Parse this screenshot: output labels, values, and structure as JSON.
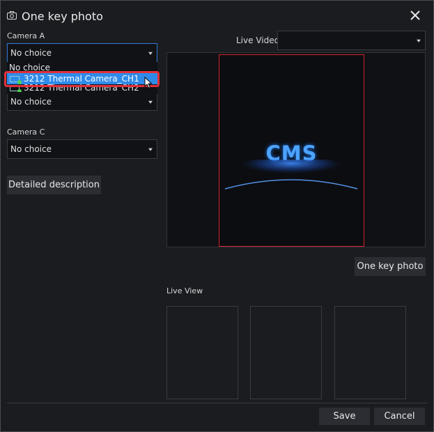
{
  "dialog": {
    "title": "One key photo",
    "icon": "camera-icon",
    "close_icon": "close-icon"
  },
  "left_panel": {
    "camera_a": {
      "label": "Camera A",
      "value": "No choice"
    },
    "dropdown_items": [
      {
        "label": "No choice"
      },
      {
        "label": "3212 Thermal Camera_CH1",
        "icon": "camera-icon",
        "selected": true
      },
      {
        "label": "3212 Thermal Camera_CH2",
        "icon": "camera-icon"
      }
    ],
    "camera_b": {
      "value": "No choice"
    },
    "camera_c": {
      "label": "Camera C",
      "value": "No choice"
    },
    "detailed_button": "Detailed description"
  },
  "right_panel": {
    "live_video_label": "Live Video",
    "live_video_value": "",
    "preview_logo": "CMS",
    "one_key_button": "One key photo",
    "live_view_label": "Live View"
  },
  "footer": {
    "save": "Save",
    "cancel": "Cancel"
  },
  "colors": {
    "background": "#1b1c20",
    "selection": "#2f8bea",
    "highlight_border": "#e0313a",
    "frame_border": "#d2242b",
    "logo": "#4da3ff"
  }
}
